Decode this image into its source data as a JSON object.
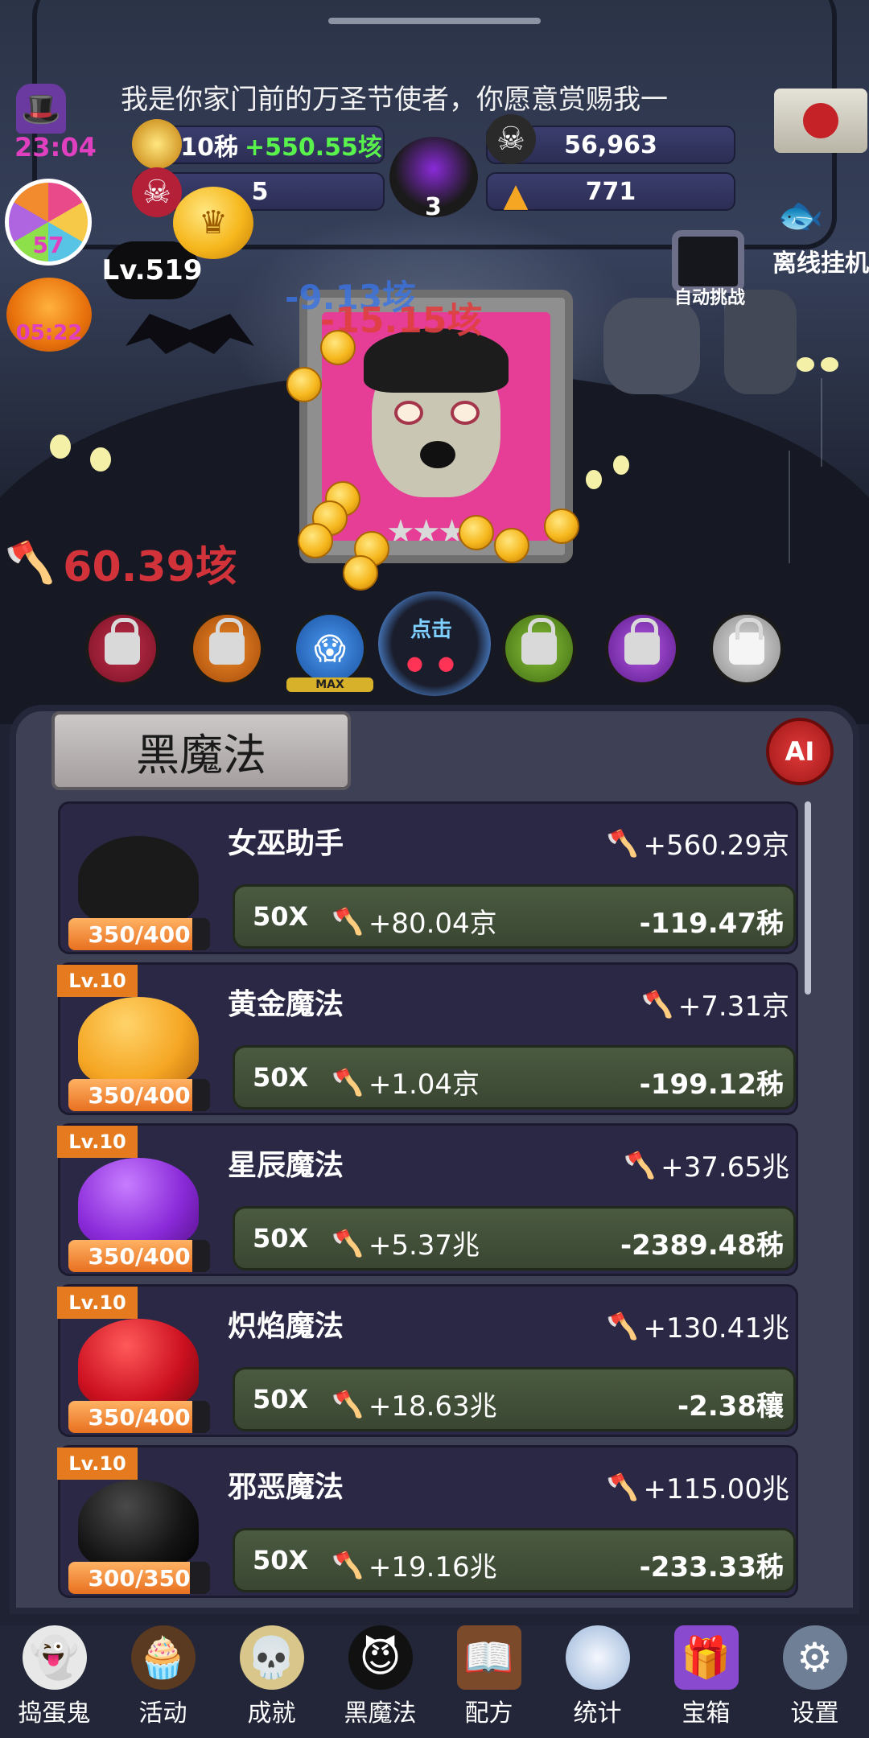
{
  "marquee_text": "我是你家门前的万圣节使者，你愿意赏赐我一",
  "timer": "23:04",
  "stats": {
    "gold": "17.10秭",
    "gold_rate": "+550.55垓",
    "kills": "56,963",
    "candy_bombs": "5",
    "cauldron": "3",
    "candy_corn": "771"
  },
  "candy_level": "57",
  "pumpkin_timer": "05:22",
  "player_level": "Lv.519",
  "offline_label": "离线挂机",
  "auto_challenge_label": "自动挑战",
  "damage_floats": [
    "-9.13垓",
    "-15.15垓"
  ],
  "tap_damage": "60.39垓",
  "skills": {
    "max_label": "MAX",
    "click_label": "点击"
  },
  "panel": {
    "title": "黑魔法",
    "ai_label": "AI"
  },
  "items": [
    {
      "name": "女巫助手",
      "dps": "+560.29京",
      "progress": "350/400",
      "progress_ratio": 0.875,
      "level": "",
      "mult": "50X",
      "add": "+80.04京",
      "cost": "-119.47秭",
      "color": "#1a1a1a"
    },
    {
      "name": "黄金魔法",
      "dps": "+7.31京",
      "progress": "350/400",
      "progress_ratio": 0.875,
      "level": "Lv.10",
      "mult": "50X",
      "add": "+1.04京",
      "cost": "-199.12秭",
      "color": "#f5a623"
    },
    {
      "name": "星辰魔法",
      "dps": "+37.65兆",
      "progress": "350/400",
      "progress_ratio": 0.875,
      "level": "Lv.10",
      "mult": "50X",
      "add": "+5.37兆",
      "cost": "-2389.48秭",
      "color": "#8a2ad9"
    },
    {
      "name": "炽焰魔法",
      "dps": "+130.41兆",
      "progress": "350/400",
      "progress_ratio": 0.875,
      "level": "Lv.10",
      "mult": "50X",
      "add": "+18.63兆",
      "cost": "-2.38穰",
      "color": "#cc1020"
    },
    {
      "name": "邪恶魔法",
      "dps": "+115.00兆",
      "progress": "300/350",
      "progress_ratio": 0.857,
      "level": "Lv.10",
      "mult": "50X",
      "add": "+19.16兆",
      "cost": "-233.33秭",
      "color": "#151515"
    }
  ],
  "nav": [
    {
      "label": "捣蛋鬼",
      "icon": "ghost-icon"
    },
    {
      "label": "活动",
      "icon": "cupcake-icon"
    },
    {
      "label": "成就",
      "icon": "skull-icon"
    },
    {
      "label": "黑魔法",
      "icon": "devil-icon"
    },
    {
      "label": "配方",
      "icon": "book-icon"
    },
    {
      "label": "统计",
      "icon": "crystal-ball-icon"
    },
    {
      "label": "宝箱",
      "icon": "gift-icon"
    },
    {
      "label": "设置",
      "icon": "gear-icon"
    }
  ]
}
